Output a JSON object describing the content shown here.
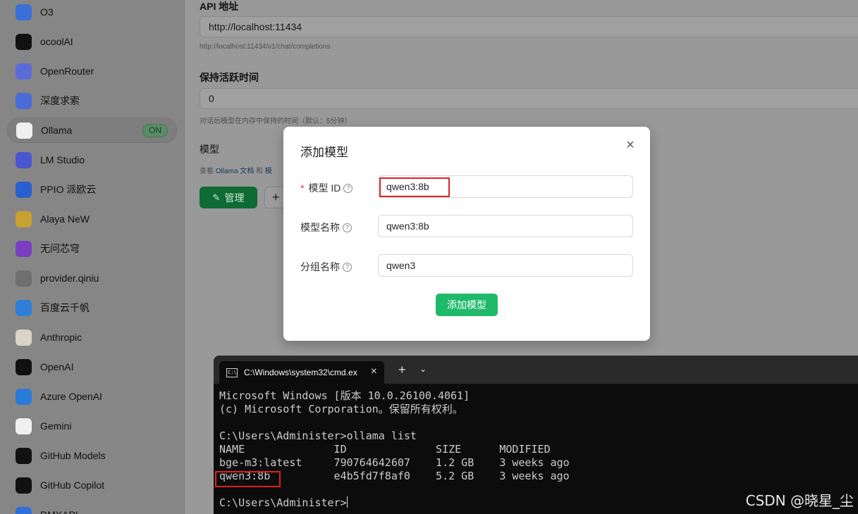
{
  "sidebar": {
    "providers": [
      {
        "label": "O3",
        "icon": "o3-icon",
        "color": "#3b6fd8"
      },
      {
        "label": "ocoolAI",
        "icon": "ocoolai-icon",
        "color": "#111111"
      },
      {
        "label": "OpenRouter",
        "icon": "openrouter-icon",
        "color": "#5a6cd8"
      },
      {
        "label": "深度求索",
        "icon": "deepseek-icon",
        "color": "#4b6bd8"
      },
      {
        "label": "Ollama",
        "icon": "ollama-icon",
        "color": "#f0f0f0",
        "active": true,
        "badge": "ON"
      },
      {
        "label": "LM Studio",
        "icon": "lmstudio-icon",
        "color": "#4a55d0"
      },
      {
        "label": "PPIO 派欧云",
        "icon": "ppio-icon",
        "color": "#2a5fd0"
      },
      {
        "label": "Alaya NeW",
        "icon": "alaya-icon",
        "color": "#c8a030"
      },
      {
        "label": "无问芯穹",
        "icon": "infini-icon",
        "color": "#7a3fc0"
      },
      {
        "label": "provider.qiniu",
        "icon": "qiniu-icon",
        "color": "#6f6f6f"
      },
      {
        "label": "百度云千帆",
        "icon": "qianfan-icon",
        "color": "#2f7fd8"
      },
      {
        "label": "Anthropic",
        "icon": "anthropic-icon",
        "color": "#d9d4c7"
      },
      {
        "label": "OpenAI",
        "icon": "openai-icon",
        "color": "#111111"
      },
      {
        "label": "Azure OpenAI",
        "icon": "azure-icon",
        "color": "#2a7ad8"
      },
      {
        "label": "Gemini",
        "icon": "gemini-icon",
        "color": "#f0f0f0"
      },
      {
        "label": "GitHub Models",
        "icon": "github-icon",
        "color": "#111111"
      },
      {
        "label": "GitHub Copilot",
        "icon": "github-copilot-icon",
        "color": "#111111"
      },
      {
        "label": "DMXAPI",
        "icon": "dmxapi-icon",
        "color": "#2f6fd8"
      }
    ]
  },
  "settings": {
    "api_title": "API 地址",
    "api_value": "http://localhost:11434",
    "api_hint": "http://localhost:11434/v1/chat/completions",
    "keepalive_title": "保持活跃时间",
    "keepalive_value": "0",
    "keepalive_hint": "对话后模型在内存中保持的时间（默认：5分钟）",
    "models_title": "模型",
    "models_hint_prefix": "查看",
    "models_hint_link": "Ollama 文档",
    "models_hint_mid": "和",
    "models_hint_link2": "模",
    "manage_label": "管理",
    "add_partial": "+"
  },
  "modal": {
    "title": "添加模型",
    "close": "×",
    "required_mark": "*",
    "model_id_label": "模型 ID",
    "model_id_value": "qwen3:8b",
    "model_name_label": "模型名称",
    "model_name_value": "qwen3:8b",
    "group_label": "分组名称",
    "group_value": "qwen3",
    "submit_label": "添加模型"
  },
  "terminal": {
    "tab_title": "C:\\Windows\\system32\\cmd.ex",
    "tab_close": "×",
    "new_tab": "+",
    "dropdown": "⌄",
    "lines": [
      "Microsoft Windows [版本 10.0.26100.4061]",
      "(c) Microsoft Corporation。保留所有权利。",
      "",
      "C:\\Users\\Administer>ollama list",
      "NAME              ID              SIZE      MODIFIED",
      "bge-m3:latest     790764642607    1.2 GB    3 weeks ago",
      "qwen3:8b          e4b5fd7f8af0    5.2 GB    3 weeks ago",
      "",
      "C:\\Users\\Administer>"
    ]
  },
  "watermark": "CSDN @晓星_尘"
}
